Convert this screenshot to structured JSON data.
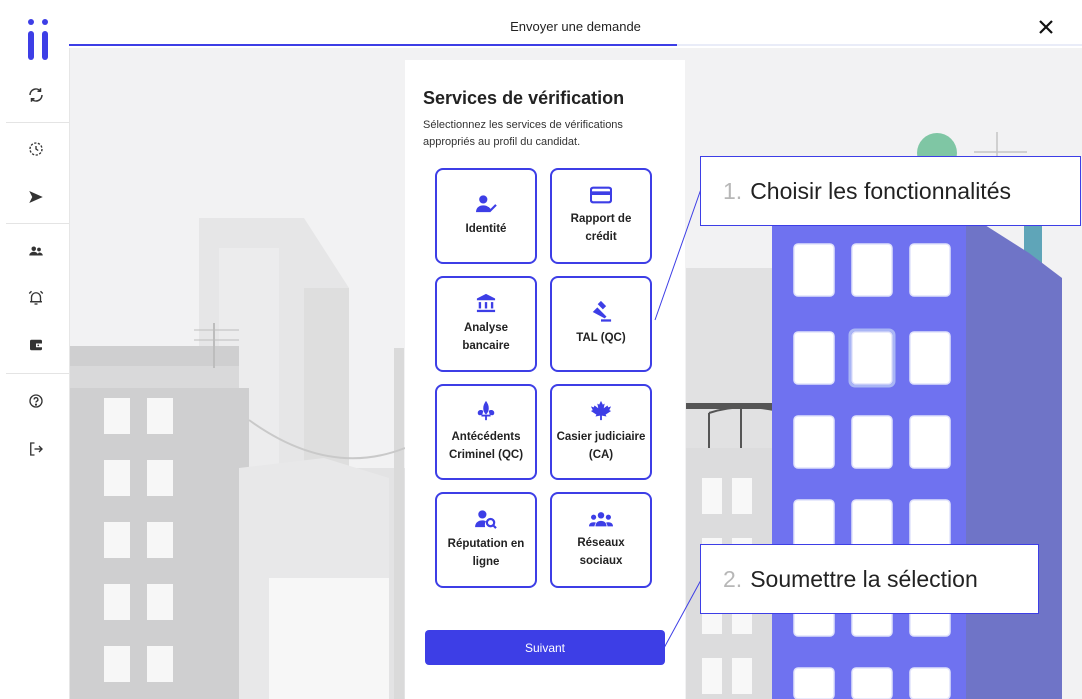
{
  "header": {
    "title": "Envoyer une demande",
    "progress": 0.6
  },
  "sidebar": {
    "icons": [
      "refresh-icon",
      "history-clock-icon",
      "send-icon",
      "users-icon",
      "alarm-bell-icon",
      "wallet-icon",
      "help-icon",
      "logout-icon"
    ]
  },
  "panel": {
    "title": "Services de vérification",
    "subtitle": "Sélectionnez les services de vérifications appropriés au profil du candidat.",
    "services": [
      {
        "label": "Identité",
        "icon": "user-check-icon"
      },
      {
        "label": "Rapport de crédit",
        "icon": "credit-card-icon"
      },
      {
        "label": "Analyse bancaire",
        "icon": "bank-icon"
      },
      {
        "label": "TAL (QC)",
        "icon": "gavel-icon"
      },
      {
        "label": "Antécédents Criminel (QC)",
        "icon": "fleur-de-lis-icon"
      },
      {
        "label": "Casier judiciaire (CA)",
        "icon": "maple-leaf-icon"
      },
      {
        "label": "Réputation en ligne",
        "icon": "user-search-icon"
      },
      {
        "label": "Réseaux sociaux",
        "icon": "group-icon"
      }
    ],
    "next_label": "Suivant"
  },
  "callouts": [
    {
      "number": "1.",
      "text": "Choisir les fonctionnalités"
    },
    {
      "number": "2.",
      "text": "Soumettre la sélection"
    }
  ],
  "colors": {
    "accent": "#3d3ee6",
    "building": "#6f72f0",
    "building_dark": "#6f74c7"
  }
}
